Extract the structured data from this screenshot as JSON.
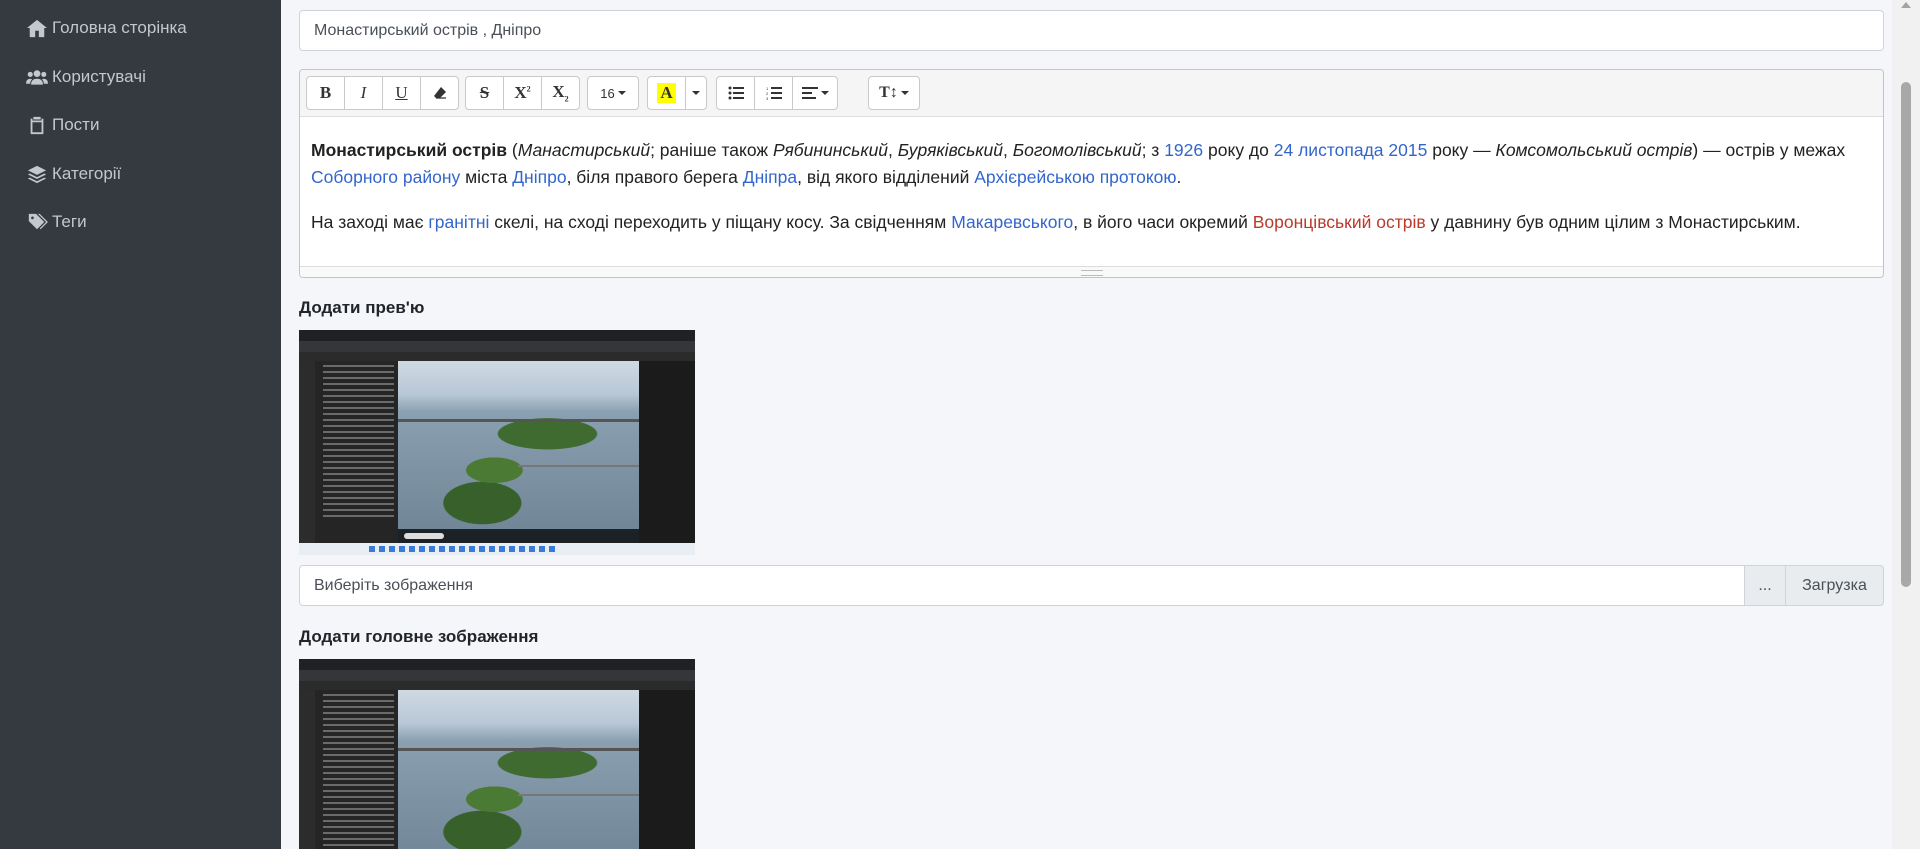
{
  "sidebar": {
    "items": [
      {
        "label": "Головна сторінка",
        "icon": "home-icon"
      },
      {
        "label": "Користувачі",
        "icon": "users-icon"
      },
      {
        "label": "Пости",
        "icon": "clipboard-icon"
      },
      {
        "label": "Категорії",
        "icon": "layers-icon"
      },
      {
        "label": "Теги",
        "icon": "tags-icon"
      }
    ]
  },
  "form": {
    "title_value": "Монастирський острів , Дніпро",
    "editor": {
      "toolbar": {
        "bold": "B",
        "italic": "I",
        "underline": "U",
        "strike": "S",
        "superscript": "X",
        "subscript": "X",
        "font_size": "16",
        "color": "A",
        "font_size_tool": "T↕"
      },
      "p1": {
        "t1": "Монастирський острів",
        "t2": " (",
        "t3": "Манастирський",
        "t4": "; раніше також ",
        "t5": "Рябининський",
        "t6": ", ",
        "t7": "Буряківський",
        "t8": ", ",
        "t9": "Богомолівський",
        "t10": "; з ",
        "l1": "1926",
        "t11": " року до ",
        "l2": "24 листопада",
        "t12": " ",
        "l3": "2015",
        "t13": " року — ",
        "t14": "Комсомольський острів",
        "t15": ") — острів у межах ",
        "l4": "Соборного району",
        "t16": " міста ",
        "l5": "Дніпро",
        "t17": ", біля правого берега ",
        "l6": "Дніпра",
        "t18": ", від якого відділений ",
        "l7": "Архієрейською протокою",
        "t19": "."
      },
      "p2": {
        "t1": "На заході має ",
        "l1": "гранітні",
        "t2": " скелі, на сході переходить у піщану косу. За свідченням ",
        "l2": "Макаревського",
        "t3": ", в його часи окремий ",
        "l3": "Воронцівський острів",
        "t4": " у давнину був одним цілим з Монастирським."
      }
    },
    "preview_label": "Додати прев'ю",
    "file_input": {
      "placeholder": "Виберіть зображення",
      "browse_label": "...",
      "upload_label": "Загрузка"
    },
    "main_image_label": "Додати головне зображення"
  },
  "colors": {
    "sidebar_bg": "#343a40",
    "link": "#3366cc",
    "redlink": "#ba3a2a",
    "highlight": "#ffff00"
  }
}
